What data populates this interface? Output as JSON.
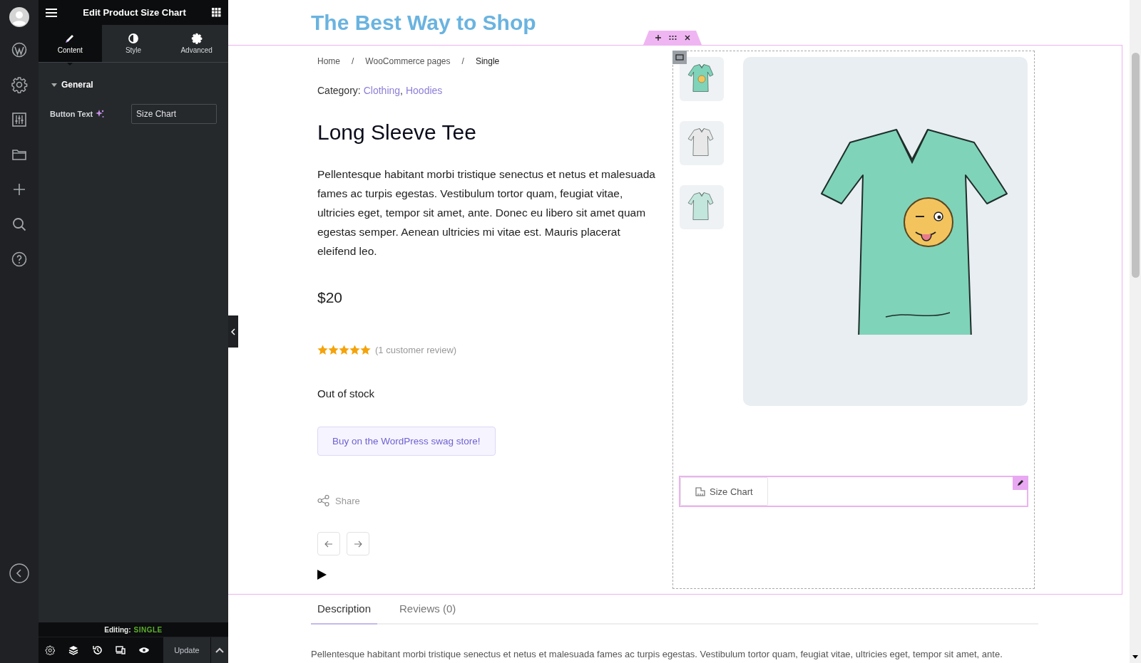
{
  "panel": {
    "title": "Edit Product Size Chart",
    "tabs": [
      {
        "label": "Content",
        "selected": true
      },
      {
        "label": "Style",
        "selected": false
      },
      {
        "label": "Advanced",
        "selected": false
      }
    ],
    "section": {
      "title": "General",
      "expanded": true
    },
    "field": {
      "label": "Button Text",
      "value": "Size Chart"
    },
    "footer": {
      "editing_label": "Editing:",
      "editing_value": "SINGLE",
      "update_button": "Update"
    }
  },
  "site_title": "The Best Way to Shop",
  "breadcrumbs": {
    "separator": "/",
    "items": [
      "Home",
      "WooCommerce pages",
      "Single"
    ]
  },
  "category": {
    "label": "Category:",
    "separator": ",",
    "links": [
      "Clothing",
      "Hoodies"
    ]
  },
  "product": {
    "title": "Long Sleeve Tee",
    "description": "Pellentesque habitant morbi tristique senectus et netus et malesuada fames ac turpis egestas. Vestibulum tortor quam, feugiat vitae, ultricies eget, tempor sit amet, ante. Donec eu libero sit amet quam egestas semper. Aenean ultricies mi vitae est. Mauris placerat eleifend leo.",
    "price": "$20",
    "stars": 5,
    "review_link": "(1 customer review)",
    "stock": "Out of stock",
    "buy_button": "Buy on the WordPress swag store!",
    "share": "Share"
  },
  "size_chart_button": "Size Chart",
  "tabs": [
    {
      "label": "Description",
      "selected": true
    },
    {
      "label": "Reviews (0)",
      "selected": false
    }
  ],
  "tab_text": "Pellentesque habitant morbi tristique senectus et netus et malesuada fames ac turpis egestas. Vestibulum tortor quam, feugiat vitae, ultricies eget, tempor sit amet, ante."
}
